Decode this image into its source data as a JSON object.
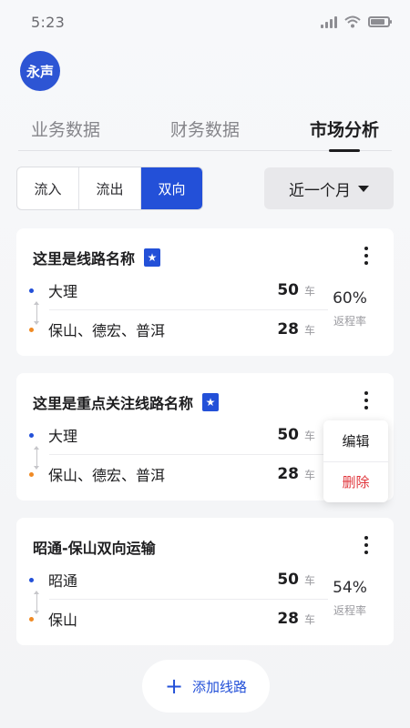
{
  "status": {
    "time": "5:23"
  },
  "avatar": {
    "text": "永声"
  },
  "tabs": [
    {
      "label": "业务数据"
    },
    {
      "label": "财务数据"
    },
    {
      "label": "市场分析"
    }
  ],
  "segment": [
    {
      "label": "流入"
    },
    {
      "label": "流出"
    },
    {
      "label": "双向"
    }
  ],
  "period": {
    "label": "近一个月"
  },
  "cards": [
    {
      "title": "这里是线路名称",
      "starred": true,
      "origin": {
        "place": "大理",
        "count": "50",
        "unit": "车"
      },
      "dest": {
        "place": "保山、德宏、普洱",
        "count": "28",
        "unit": "车"
      },
      "rate": {
        "value": "60%",
        "label": "返程率"
      }
    },
    {
      "title": "这里是重点关注线路名称",
      "starred": true,
      "origin": {
        "place": "大理",
        "count": "50",
        "unit": "车"
      },
      "dest": {
        "place": "保山、德宏、普洱",
        "count": "28",
        "unit": "车"
      }
    },
    {
      "title": "昭通-保山双向运输",
      "starred": false,
      "origin": {
        "place": "昭通",
        "count": "50",
        "unit": "车"
      },
      "dest": {
        "place": "保山",
        "count": "28",
        "unit": "车"
      },
      "rate": {
        "value": "54%",
        "label": "返程率"
      }
    }
  ],
  "menu": {
    "edit": "编辑",
    "delete": "删除"
  },
  "add_route": {
    "label": "添加线路",
    "icon": "plus-icon"
  },
  "colors": {
    "accent": "#2350d8",
    "origin_dot": "#2350d8",
    "dest_dot": "#f08a24",
    "danger": "#e0353b"
  }
}
